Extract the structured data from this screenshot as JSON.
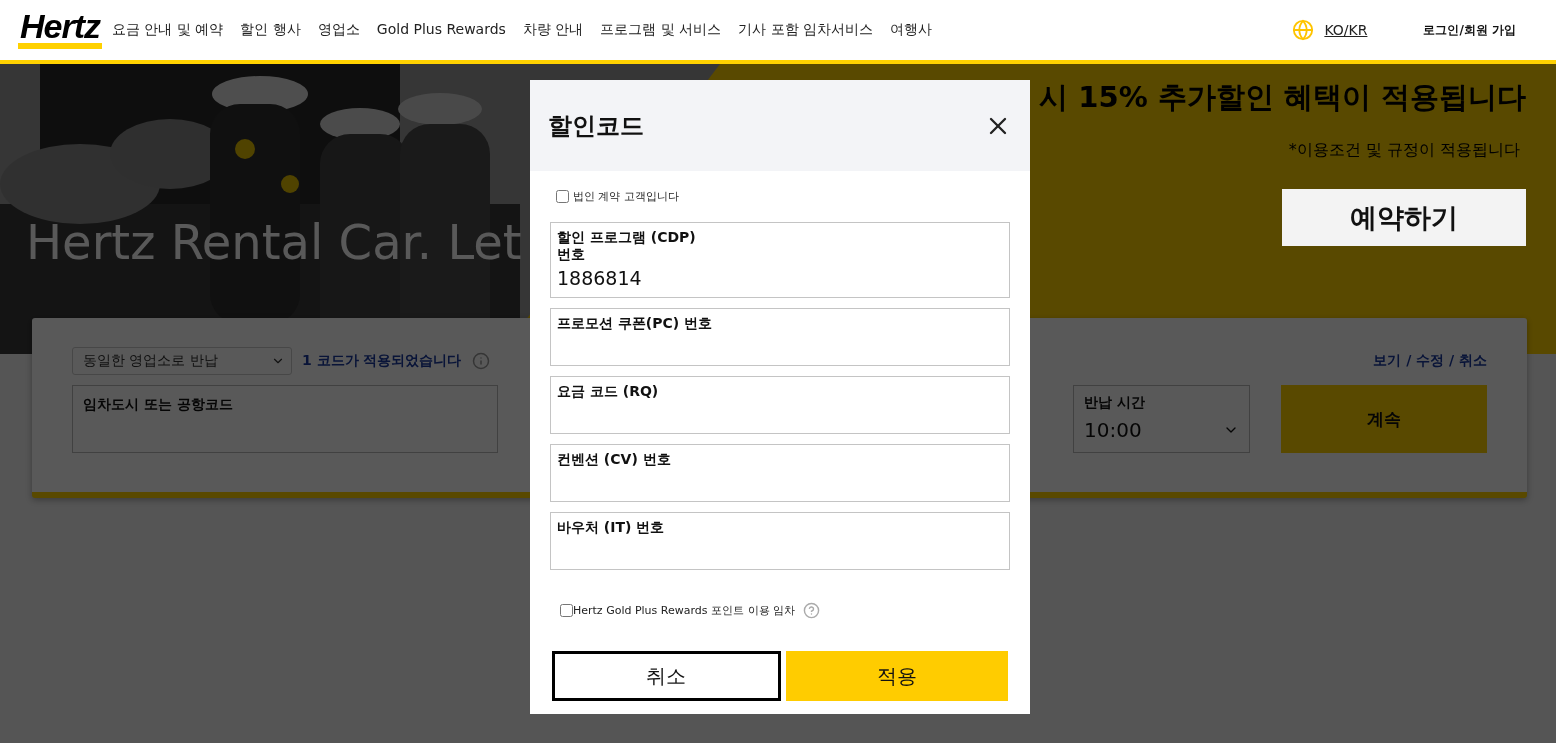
{
  "header": {
    "logo": "Hertz",
    "nav": [
      "요금 안내 및 예약",
      "할인 행사",
      "영업소",
      "Gold Plus Rewards",
      "차량 안내",
      "프로그램 및 서비스",
      "기사 포함 임차서비스",
      "여행사"
    ],
    "language": "KO/KR",
    "login": "로그인/회원 가입"
  },
  "hero": {
    "title": "Hertz Rental Car. Let",
    "promo": "시 15% 추가할인 혜택이 적용됩니다",
    "terms": "*이용조건 및 규정이 적용됩니다",
    "book_button": "예약하기"
  },
  "booking": {
    "return_select": "동일한 영업소로 반납",
    "codes_link": "1 코드가 적용되었습니다",
    "manage_link": "보기 / 수정 / 취소",
    "pickup_field": {
      "label": "임차도시 또는 공항코드"
    },
    "return_time": {
      "label": "반납 시간",
      "value": "10:00"
    },
    "continue_button": "계속"
  },
  "modal": {
    "title": "할인코드",
    "corporate": {
      "label": "법인 계약 고객입니다",
      "checked": false
    },
    "fields": [
      {
        "label": "할인 프로그램 (CDP) 번호",
        "value": "1886814"
      },
      {
        "label": "프로모션 쿠폰(PC) 번호"
      },
      {
        "label": "요금 코드 (RQ)"
      },
      {
        "label": "컨벤션 (CV) 번호"
      },
      {
        "label": "바우처 (IT) 번호"
      }
    ],
    "points": {
      "label": "Hertz Gold Plus Rewards 포인트 이용 임차",
      "checked": false
    },
    "cancel_button": "취소",
    "apply_button": "적용"
  }
}
